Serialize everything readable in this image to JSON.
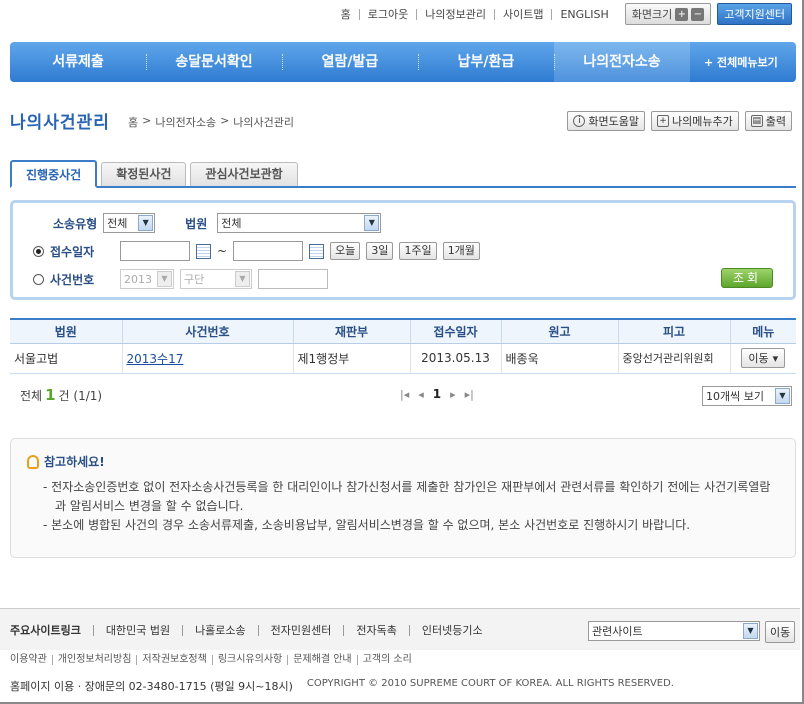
{
  "topbar": {
    "links": [
      "홈",
      "로그아웃",
      "나의정보관리",
      "사이트맵",
      "ENGLISH"
    ],
    "zoom_label": "화면크기",
    "zoom_in": "+",
    "zoom_out": "−",
    "support": "고객지원센터"
  },
  "nav": {
    "items": [
      "서류제출",
      "송달문서확인",
      "열람/발급",
      "납부/환급",
      "나의전자소송"
    ],
    "all_menu": "+ 전체메뉴보기"
  },
  "page": {
    "title": "나의사건관리",
    "breadcrumb": [
      "홈",
      ">",
      "나의전자소송",
      ">",
      "나의사건관리"
    ],
    "help": "화면도움말",
    "add_menu": "나의메뉴추가",
    "print": "출력"
  },
  "tabs": [
    "진행중사건",
    "확정된사건",
    "관심사건보관함"
  ],
  "search": {
    "type_label": "소송유형",
    "type_value": "전체",
    "court_label": "법원",
    "court_value": "전체",
    "date_label": "접수일자",
    "tilde": "~",
    "quick": [
      "오늘",
      "3일",
      "1주일",
      "1개월"
    ],
    "case_label": "사건번호",
    "year_value": "2013",
    "kind_value": "구단",
    "submit": "조회"
  },
  "table": {
    "headers": [
      "법원",
      "사건번호",
      "재판부",
      "접수일자",
      "원고",
      "피고",
      "메뉴"
    ],
    "rows": [
      {
        "court": "서울고법",
        "case_no": "2013수17",
        "bench": "제1행정부",
        "date": "2013.05.13",
        "plaintiff": "배종욱",
        "defendant": "중앙선거관리위원회",
        "menu": "이동"
      }
    ]
  },
  "summary": {
    "prefix": "전체",
    "count": "1",
    "suffix": "건 (1/1)",
    "page": "1",
    "per_page": "10개씩 보기"
  },
  "notice": {
    "title": "참고하세요!",
    "items": [
      "- 전자소송인증번호 없이 전자소송사건등록을 한 대리인이나 참가신청서를 제출한 참가인은 재판부에서 관련서류를 확인하기 전에는 사건기록열람과 알림서비스 변경을 할 수 없습니다.",
      "- 본소에 병합된 사건의 경우 소송서류제출, 소송비용납부, 알림서비스변경을 할 수 없으며, 본소 사건번호로 진행하시기 바랍니다."
    ]
  },
  "footer": {
    "sites": [
      "주요사이트링크",
      "대한민국 법원",
      "나홀로소송",
      "전자민원센터",
      "전자독촉",
      "인터넷등기소"
    ],
    "related": "관련사이트",
    "move": "이동",
    "links": [
      "이용약관",
      "개인정보처리방침",
      "저작권보호정책",
      "링크시유의사항",
      "문제해결 안내",
      "고객의 소리"
    ],
    "contact": "홈페이지 이용 · 장애문의 02-3480-1715 (평일 9시~18시)",
    "copyright": "COPYRIGHT © 2010 SUPREME COURT OF KOREA. ALL RIGHTS RESERVED."
  }
}
